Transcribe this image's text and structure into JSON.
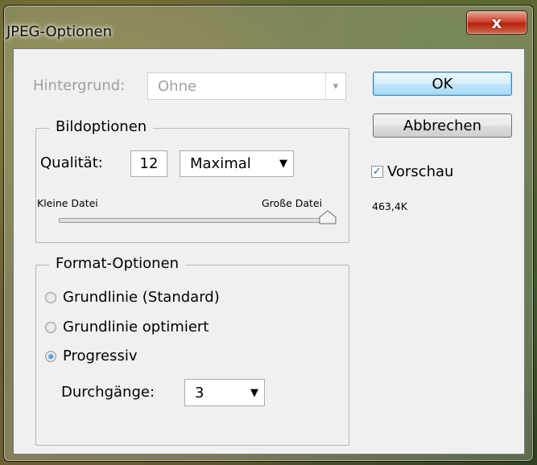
{
  "window": {
    "title": "JPEG-Optionen",
    "close_label": "x"
  },
  "background_field": {
    "label": "Hintergrund:",
    "value": "Ohne"
  },
  "image_options": {
    "legend": "Bildoptionen",
    "quality_label": "Qualität:",
    "quality_value": "12",
    "quality_preset": "Maximal",
    "slider_min_label": "Kleine Datei",
    "slider_max_label": "Große Datei",
    "slider_level_fraction": 1.0
  },
  "format_options": {
    "legend": "Format-Optionen",
    "options": [
      {
        "label": "Grundlinie (Standard)",
        "selected": false
      },
      {
        "label": "Grundlinie optimiert",
        "selected": false
      },
      {
        "label": "Progressiv",
        "selected": true
      }
    ],
    "passes_label": "Durchgänge:",
    "passes_value": "3"
  },
  "buttons": {
    "ok": "OK",
    "cancel": "Abbrechen"
  },
  "preview": {
    "label": "Vorschau",
    "checked": true,
    "file_size": "463,4K"
  },
  "colors": {
    "default_button_border": "#3c7fb1",
    "radio_selected": "#1a5fa8",
    "close_button": "#c4402a"
  }
}
